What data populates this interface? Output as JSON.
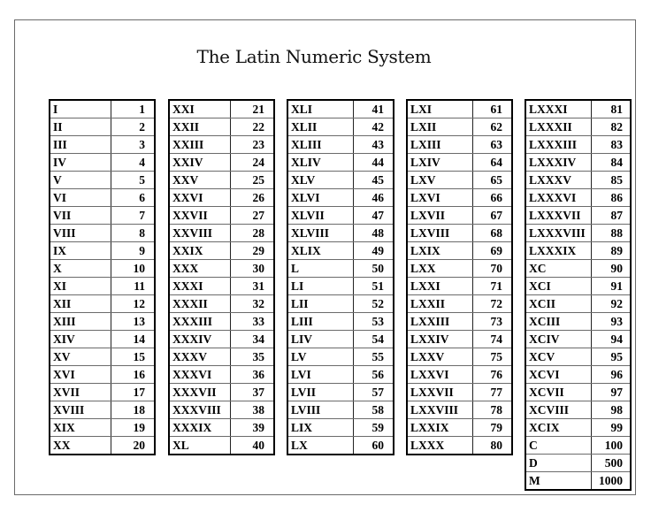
{
  "title": "The Latin Numeric System",
  "tables": [
    {
      "rows": [
        [
          "I",
          "1"
        ],
        [
          "II",
          "2"
        ],
        [
          "III",
          "3"
        ],
        [
          "IV",
          "4"
        ],
        [
          "V",
          "5"
        ],
        [
          "VI",
          "6"
        ],
        [
          "VII",
          "7"
        ],
        [
          "VIII",
          "8"
        ],
        [
          "IX",
          "9"
        ],
        [
          "X",
          "10"
        ],
        [
          "XI",
          "11"
        ],
        [
          "XII",
          "12"
        ],
        [
          "XIII",
          "13"
        ],
        [
          "XIV",
          "14"
        ],
        [
          "XV",
          "15"
        ],
        [
          "XVI",
          "16"
        ],
        [
          "XVII",
          "17"
        ],
        [
          "XVIII",
          "18"
        ],
        [
          "XIX",
          "19"
        ],
        [
          "XX",
          "20"
        ]
      ]
    },
    {
      "rows": [
        [
          "XXI",
          "21"
        ],
        [
          "XXII",
          "22"
        ],
        [
          "XXIII",
          "23"
        ],
        [
          "XXIV",
          "24"
        ],
        [
          "XXV",
          "25"
        ],
        [
          "XXVI",
          "26"
        ],
        [
          "XXVII",
          "27"
        ],
        [
          "XXVIII",
          "28"
        ],
        [
          "XXIX",
          "29"
        ],
        [
          "XXX",
          "30"
        ],
        [
          "XXXI",
          "31"
        ],
        [
          "XXXII",
          "32"
        ],
        [
          "XXXIII",
          "33"
        ],
        [
          "XXXIV",
          "34"
        ],
        [
          "XXXV",
          "35"
        ],
        [
          "XXXVI",
          "36"
        ],
        [
          "XXXVII",
          "37"
        ],
        [
          "XXXVIII",
          "38"
        ],
        [
          "XXXIX",
          "39"
        ],
        [
          "XL",
          "40"
        ]
      ]
    },
    {
      "rows": [
        [
          "XLI",
          "41"
        ],
        [
          "XLII",
          "42"
        ],
        [
          "XLIII",
          "43"
        ],
        [
          "XLIV",
          "44"
        ],
        [
          "XLV",
          "45"
        ],
        [
          "XLVI",
          "46"
        ],
        [
          "XLVII",
          "47"
        ],
        [
          "XLVIII",
          "48"
        ],
        [
          "XLIX",
          "49"
        ],
        [
          "L",
          "50"
        ],
        [
          "LI",
          "51"
        ],
        [
          "LII",
          "52"
        ],
        [
          "LIII",
          "53"
        ],
        [
          "LIV",
          "54"
        ],
        [
          "LV",
          "55"
        ],
        [
          "LVI",
          "56"
        ],
        [
          "LVII",
          "57"
        ],
        [
          "LVIII",
          "58"
        ],
        [
          "LIX",
          "59"
        ],
        [
          "LX",
          "60"
        ]
      ]
    },
    {
      "rows": [
        [
          "LXI",
          "61"
        ],
        [
          "LXII",
          "62"
        ],
        [
          "LXIII",
          "63"
        ],
        [
          "LXIV",
          "64"
        ],
        [
          "LXV",
          "65"
        ],
        [
          "LXVI",
          "66"
        ],
        [
          "LXVII",
          "67"
        ],
        [
          "LXVIII",
          "68"
        ],
        [
          "LXIX",
          "69"
        ],
        [
          "LXX",
          "70"
        ],
        [
          "LXXI",
          "71"
        ],
        [
          "LXXII",
          "72"
        ],
        [
          "LXXIII",
          "73"
        ],
        [
          "LXXIV",
          "74"
        ],
        [
          "LXXV",
          "75"
        ],
        [
          "LXXVI",
          "76"
        ],
        [
          "LXXVII",
          "77"
        ],
        [
          "LXXVIII",
          "78"
        ],
        [
          "LXXIX",
          "79"
        ],
        [
          "LXXX",
          "80"
        ]
      ]
    },
    {
      "rows": [
        [
          "LXXXI",
          "81"
        ],
        [
          "LXXXII",
          "82"
        ],
        [
          "LXXXIII",
          "83"
        ],
        [
          "LXXXIV",
          "84"
        ],
        [
          "LXXXV",
          "85"
        ],
        [
          "LXXXVI",
          "86"
        ],
        [
          "LXXXVII",
          "87"
        ],
        [
          "LXXXVIII",
          "88"
        ],
        [
          "LXXXIX",
          "89"
        ],
        [
          "XC",
          "90"
        ],
        [
          "XCI",
          "91"
        ],
        [
          "XCII",
          "92"
        ],
        [
          "XCIII",
          "93"
        ],
        [
          "XCIV",
          "94"
        ],
        [
          "XCV",
          "95"
        ],
        [
          "XCVI",
          "96"
        ],
        [
          "XCVII",
          "97"
        ],
        [
          "XCVIII",
          "98"
        ],
        [
          "XCIX",
          "99"
        ],
        [
          "C",
          "100"
        ],
        [
          "D",
          "500"
        ],
        [
          "M",
          "1000"
        ]
      ]
    }
  ]
}
